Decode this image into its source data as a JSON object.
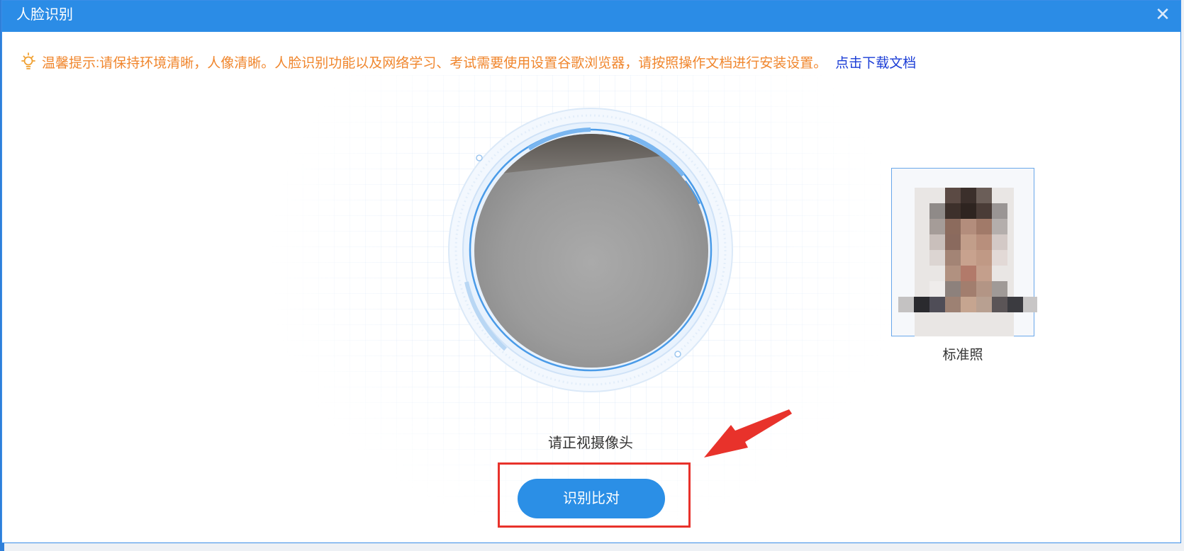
{
  "dialog": {
    "title": "人脸识别",
    "close_symbol": "✕",
    "close_icon": "close-icon"
  },
  "tip": {
    "icon": "lightbulb-icon",
    "text": "温馨提示:请保持环境清晰，人像清晰。人脸识别功能以及网络学习、考试需要使用设置谷歌浏览器，请按照操作文档进行安装设置。",
    "link_label": "点击下载文档"
  },
  "camera": {
    "prompt": "请正视摄像头"
  },
  "reference_photo": {
    "caption": "标准照"
  },
  "actions": {
    "compare_label": "识别比对"
  },
  "colors": {
    "accent": "#2b8ce6",
    "tip": "#f0862d",
    "link": "#1a3cd6",
    "annotation": "#e8322b"
  }
}
